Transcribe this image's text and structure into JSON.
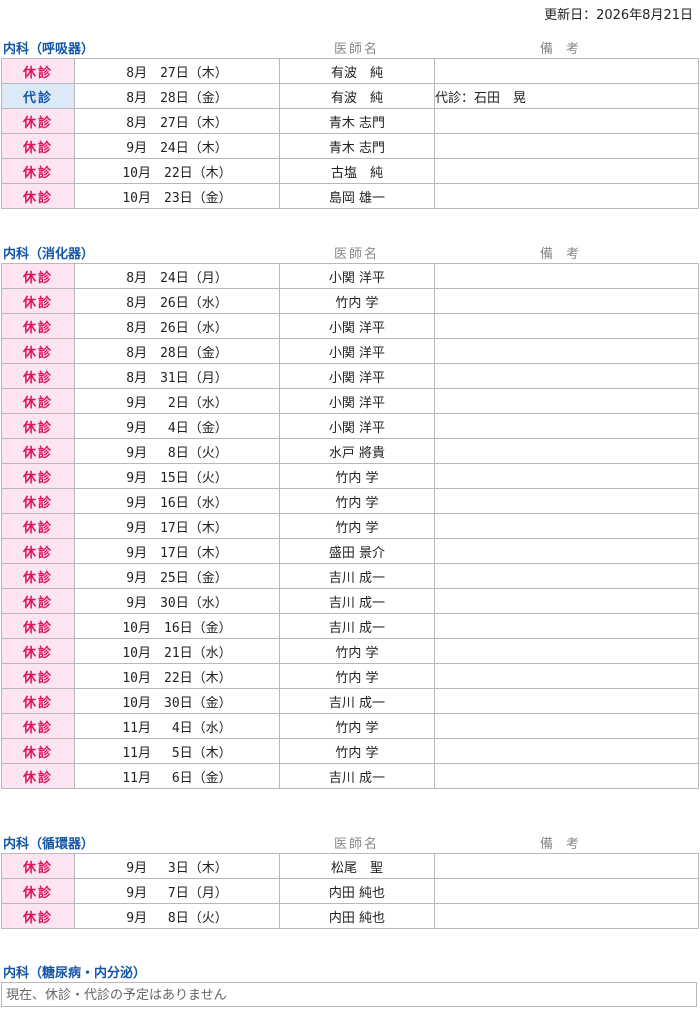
{
  "updated": "更新日：2026年8月21日",
  "header_labels": {
    "doctor": "医師名",
    "note": "備　考"
  },
  "sections": [
    {
      "dept": "内科（呼吸器）",
      "rows": [
        {
          "status": "休診",
          "kind": "kyu",
          "date": "8月　27日（木）",
          "doctor": "有波　純",
          "note": ""
        },
        {
          "status": "代診",
          "kind": "dai",
          "date": "8月　28日（金）",
          "doctor": "有波　純",
          "note": "代診：石田　晃"
        },
        {
          "status": "休診",
          "kind": "kyu",
          "date": "8月　27日（木）",
          "doctor": "青木 志門",
          "note": ""
        },
        {
          "status": "休診",
          "kind": "kyu",
          "date": "9月　24日（木）",
          "doctor": "青木 志門",
          "note": ""
        },
        {
          "status": "休診",
          "kind": "kyu",
          "date": "10月　22日（木）",
          "doctor": "古塩　純",
          "note": ""
        },
        {
          "status": "休診",
          "kind": "kyu",
          "date": "10月　23日（金）",
          "doctor": "島岡 雄一",
          "note": ""
        }
      ]
    },
    {
      "dept": "内科（消化器）",
      "rows": [
        {
          "status": "休診",
          "kind": "kyu",
          "date": "8月　24日（月）",
          "doctor": "小関 洋平",
          "note": ""
        },
        {
          "status": "休診",
          "kind": "kyu",
          "date": "8月　26日（水）",
          "doctor": "竹内 学",
          "note": ""
        },
        {
          "status": "休診",
          "kind": "kyu",
          "date": "8月　26日（水）",
          "doctor": "小関 洋平",
          "note": ""
        },
        {
          "status": "休診",
          "kind": "kyu",
          "date": "8月　28日（金）",
          "doctor": "小関 洋平",
          "note": ""
        },
        {
          "status": "休診",
          "kind": "kyu",
          "date": "8月　31日（月）",
          "doctor": "小関 洋平",
          "note": ""
        },
        {
          "status": "休診",
          "kind": "kyu",
          "date": "9月　 2日（水）",
          "doctor": "小関 洋平",
          "note": ""
        },
        {
          "status": "休診",
          "kind": "kyu",
          "date": "9月　 4日（金）",
          "doctor": "小関 洋平",
          "note": ""
        },
        {
          "status": "休診",
          "kind": "kyu",
          "date": "9月　 8日（火）",
          "doctor": "水戸 將貴",
          "note": ""
        },
        {
          "status": "休診",
          "kind": "kyu",
          "date": "9月　15日（火）",
          "doctor": "竹内 学",
          "note": ""
        },
        {
          "status": "休診",
          "kind": "kyu",
          "date": "9月　16日（水）",
          "doctor": "竹内 学",
          "note": ""
        },
        {
          "status": "休診",
          "kind": "kyu",
          "date": "9月　17日（木）",
          "doctor": "竹内 学",
          "note": ""
        },
        {
          "status": "休診",
          "kind": "kyu",
          "date": "9月　17日（木）",
          "doctor": "盛田 景介",
          "note": ""
        },
        {
          "status": "休診",
          "kind": "kyu",
          "date": "9月　25日（金）",
          "doctor": "吉川 成一",
          "note": ""
        },
        {
          "status": "休診",
          "kind": "kyu",
          "date": "9月　30日（水）",
          "doctor": "吉川 成一",
          "note": ""
        },
        {
          "status": "休診",
          "kind": "kyu",
          "date": "10月　16日（金）",
          "doctor": "吉川 成一",
          "note": ""
        },
        {
          "status": "休診",
          "kind": "kyu",
          "date": "10月　21日（水）",
          "doctor": "竹内 学",
          "note": ""
        },
        {
          "status": "休診",
          "kind": "kyu",
          "date": "10月　22日（木）",
          "doctor": "竹内 学",
          "note": ""
        },
        {
          "status": "休診",
          "kind": "kyu",
          "date": "10月　30日（金）",
          "doctor": "吉川 成一",
          "note": ""
        },
        {
          "status": "休診",
          "kind": "kyu",
          "date": "11月　 4日（水）",
          "doctor": "竹内 学",
          "note": ""
        },
        {
          "status": "休診",
          "kind": "kyu",
          "date": "11月　 5日（木）",
          "doctor": "竹内 学",
          "note": ""
        },
        {
          "status": "休診",
          "kind": "kyu",
          "date": "11月　 6日（金）",
          "doctor": "吉川 成一",
          "note": ""
        }
      ]
    },
    {
      "dept": "内科（循環器）",
      "rows": [
        {
          "status": "休診",
          "kind": "kyu",
          "date": "9月　 3日（木）",
          "doctor": "松尾　聖",
          "note": ""
        },
        {
          "status": "休診",
          "kind": "kyu",
          "date": "9月　 7日（月）",
          "doctor": "内田 純也",
          "note": ""
        },
        {
          "status": "休診",
          "kind": "kyu",
          "date": "9月　 8日（火）",
          "doctor": "内田 純也",
          "note": ""
        }
      ]
    }
  ],
  "last_section": {
    "dept": "内科（糖尿病・内分泌）",
    "message": "現在、休診・代診の予定はありません"
  }
}
